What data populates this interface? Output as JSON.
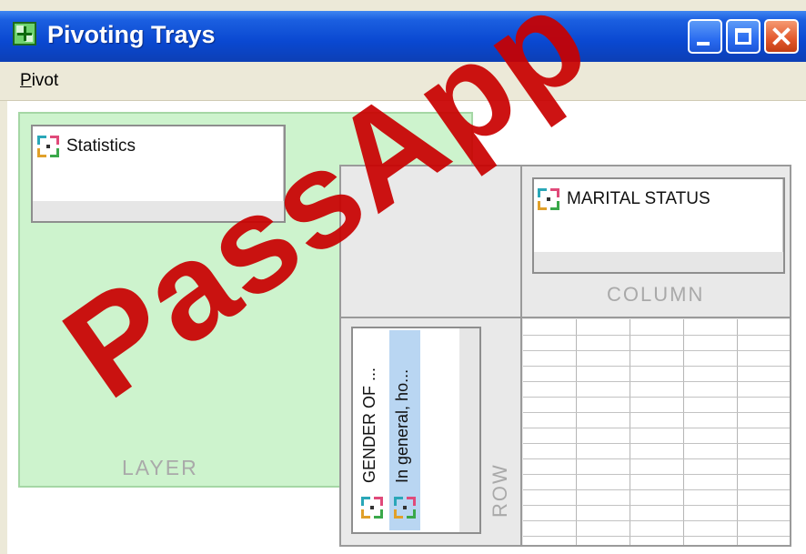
{
  "window": {
    "title": "Pivoting Trays",
    "app_icon": "pivot-tray-icon",
    "controls": [
      "minimize",
      "maximize",
      "close"
    ]
  },
  "menu": {
    "items": [
      {
        "label": "Pivot"
      }
    ]
  },
  "trays": {
    "layer": {
      "caption": "LAYER",
      "items": [
        {
          "label": "Statistics",
          "icon": "pivot-dimension-icon"
        }
      ]
    },
    "column": {
      "caption": "COLUMN",
      "items": [
        {
          "label": "MARITAL STATUS",
          "icon": "pivot-dimension-icon"
        }
      ]
    },
    "row": {
      "caption": "ROW",
      "items": [
        {
          "label": "GENDER OF ...",
          "icon": "pivot-dimension-icon"
        },
        {
          "label": "In general, ho...",
          "icon": "pivot-dimension-icon",
          "selected": true
        }
      ]
    }
  },
  "watermark": {
    "text": "PassApp"
  },
  "colors": {
    "titlebar": "#0a48d1",
    "layer_tray": "#cdf3cd",
    "selected_item": "#b9d6f2",
    "caption_text": "#a9a9a9",
    "watermark": "#c90000"
  }
}
